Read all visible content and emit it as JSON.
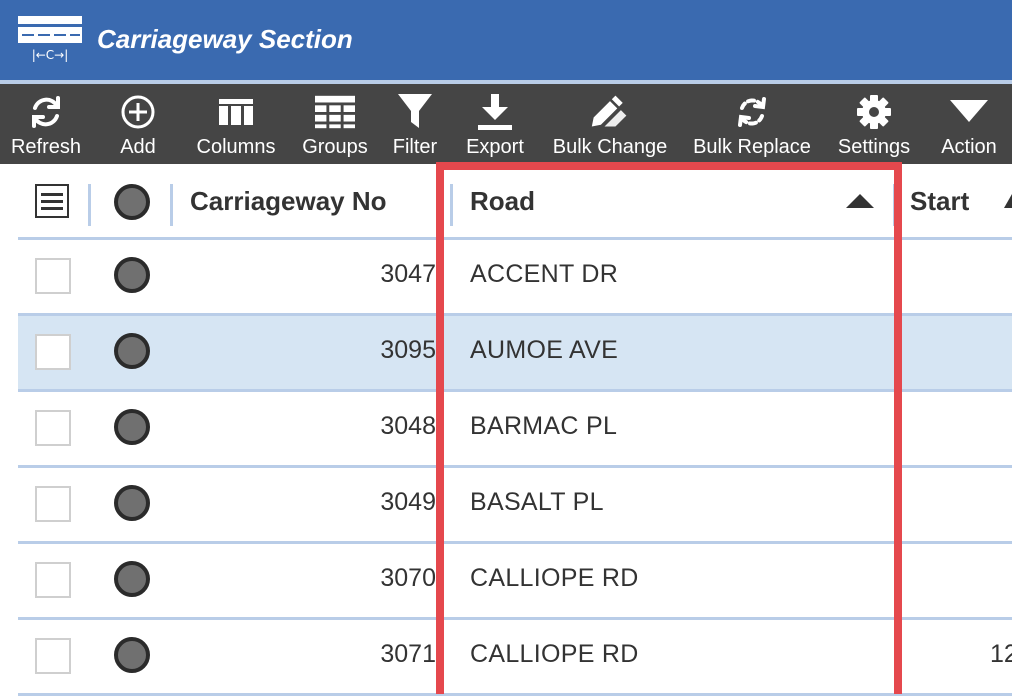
{
  "app": {
    "title": "Carriageway Section",
    "icon": "carriageway-icon",
    "icon_text": "|←C→|"
  },
  "toolbar": [
    {
      "label": "Refresh",
      "icon": "refresh-icon"
    },
    {
      "label": "Add",
      "icon": "add-icon"
    },
    {
      "label": "Columns",
      "icon": "columns-icon"
    },
    {
      "label": "Groups",
      "icon": "groups-icon"
    },
    {
      "label": "Filter",
      "icon": "filter-icon"
    },
    {
      "label": "Export",
      "icon": "export-icon"
    },
    {
      "label": "Bulk Change",
      "icon": "bulk-change-icon"
    },
    {
      "label": "Bulk Replace",
      "icon": "bulk-replace-icon"
    },
    {
      "label": "Settings",
      "icon": "gear-icon"
    },
    {
      "label": "Action",
      "icon": "caret-down-icon"
    }
  ],
  "grid": {
    "columns": [
      {
        "label": "Carriageway No"
      },
      {
        "label": "Road",
        "sort": "ascending"
      },
      {
        "label": "Start"
      }
    ],
    "rows": [
      {
        "carriageway_no": "3047",
        "road": "ACCENT DR",
        "start": "",
        "selected": false
      },
      {
        "carriageway_no": "3095",
        "road": "AUMOE AVE",
        "start": "",
        "selected": true
      },
      {
        "carriageway_no": "3048",
        "road": "BARMAC PL",
        "start": "",
        "selected": false
      },
      {
        "carriageway_no": "3049",
        "road": "BASALT PL",
        "start": "",
        "selected": false
      },
      {
        "carriageway_no": "3070",
        "road": "CALLIOPE RD",
        "start": "",
        "selected": false
      },
      {
        "carriageway_no": "3071",
        "road": "CALLIOPE RD",
        "start": "12",
        "selected": false
      }
    ]
  },
  "colors": {
    "title_bar": "#3a6ab0",
    "toolbar": "#454545",
    "selected_row": "#d6e5f3",
    "highlight": "#e5484d"
  }
}
